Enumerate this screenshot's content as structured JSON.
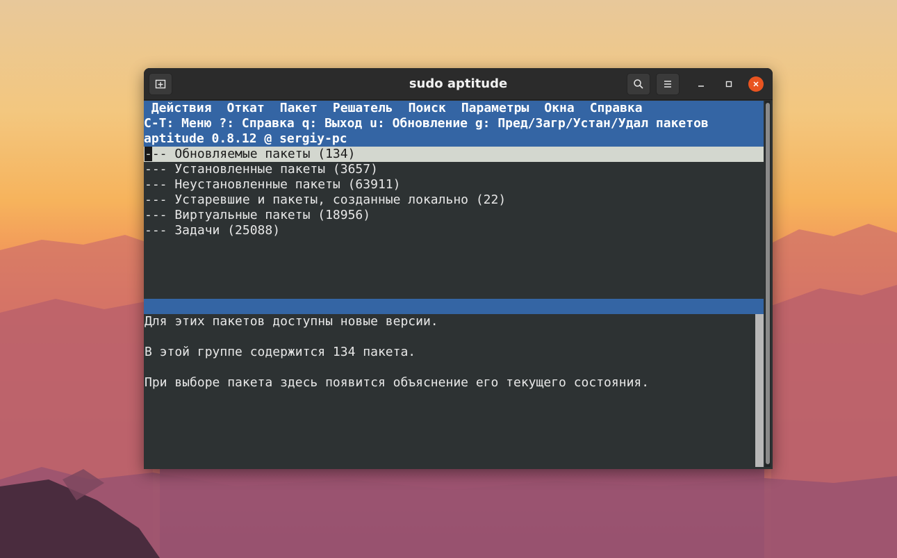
{
  "window": {
    "title": "sudo aptitude",
    "new_tab_icon": "new-tab-icon",
    "search_icon": "search-icon",
    "menu_icon": "hamburger-menu-icon",
    "minimize_icon": "minimize-icon",
    "maximize_icon": "maximize-icon",
    "close_icon": "close-icon",
    "close_color": "#e95420"
  },
  "terminal": {
    "menu": [
      "Действия",
      "Откат",
      "Пакет",
      "Решатель",
      "Поиск",
      "Параметры",
      "Окна",
      "Справка"
    ],
    "hint": "C-T: Меню ?: Справка q: Выход u: Обновление g: Пред/Загр/Устан/Удал пакетов",
    "version": "aptitude 0.8.12 @ sergiy-pc",
    "selected_cursor": "-",
    "selected_rest": "-- Обновляемые пакеты (134)",
    "groups": [
      "--- Установленные пакеты (3657)",
      "--- Неустановленные пакеты (63911)",
      "--- Устаревшие и пакеты, созданные локально (22)",
      "--- Виртуальные пакеты (18956)",
      "--- Задачи (25088)"
    ],
    "info": [
      "Для этих пакетов доступны новые версии.",
      "В этой группе содержится 134 пакета.",
      "При выборе пакета здесь появится объяснение его текущего состояния."
    ],
    "accent_color": "#3465a4"
  }
}
